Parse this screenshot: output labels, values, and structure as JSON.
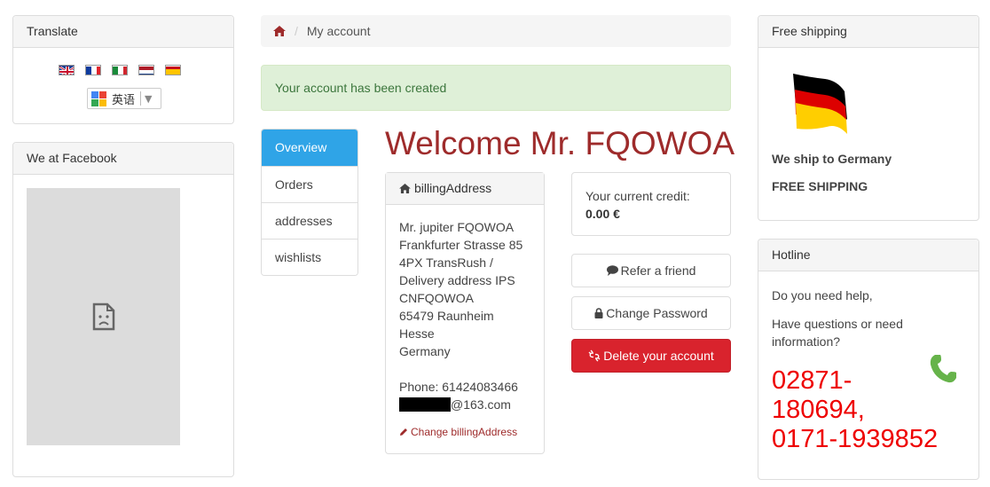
{
  "translate": {
    "title": "Translate",
    "flags": [
      "flag-uk-icon",
      "flag-france-icon",
      "flag-italy-icon",
      "flag-netherlands-icon",
      "flag-spain-icon"
    ],
    "selected_language": "英语"
  },
  "facebook": {
    "title": "We at Facebook"
  },
  "breadcrumb": {
    "current": "My account"
  },
  "alert": {
    "message": "Your account has been created"
  },
  "account_nav": {
    "items": [
      "Overview",
      "Orders",
      "addresses",
      "wishlists"
    ]
  },
  "welcome": "Welcome Mr. FQOWOA",
  "billing": {
    "title": "billingAddress",
    "lines": [
      "Mr. jupiter FQOWOA",
      "Frankfurter Strasse 85",
      "4PX TransRush /",
      "Delivery address IPS",
      "CNFQOWOA",
      "65479 Raunheim",
      "Hesse",
      "Germany"
    ],
    "phone": "Phone: 61424083466",
    "email_suffix": "@163.com",
    "change_link": "Change billingAddress"
  },
  "credit": {
    "label": "Your current credit:",
    "value": "0.00 €"
  },
  "buttons": {
    "refer": "Refer a friend",
    "change_password": "Change Password",
    "delete_account": "Delete your account"
  },
  "shipping": {
    "title": "Free shipping",
    "ship_to": "We ship to Germany",
    "free": "FREE SHIPPING"
  },
  "hotline": {
    "title": "Hotline",
    "help": "Do you need help,",
    "questions": "Have questions or need information?",
    "phone_lines": [
      "02871-",
      "180694,",
      "0171-1939852"
    ]
  },
  "colors": {
    "accent_red": "#9e2b2b",
    "nav_active": "#2fa4e7",
    "danger": "#d9232d",
    "success_bg": "#dff0d8",
    "hotline_red": "#ee0000"
  }
}
